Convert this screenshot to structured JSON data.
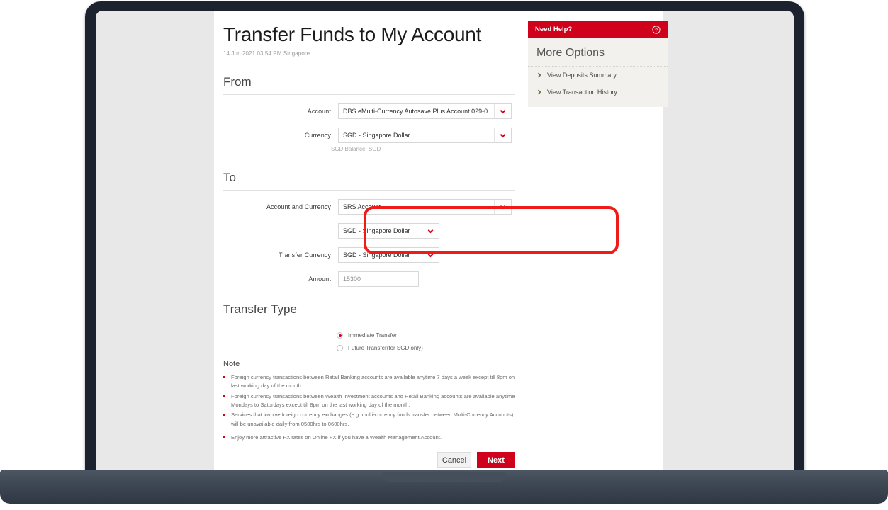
{
  "page": {
    "title": "Transfer Funds to My Account",
    "timestamp": "14 Jun 2021 03:54 PM Singapore"
  },
  "colors": {
    "brand_red": "#d0021b",
    "annotation_red": "#ee1c18",
    "sidebar_bg": "#f3f1ed",
    "page_bg": "#e8e8e8"
  },
  "from_section": {
    "heading": "From",
    "account_label": "Account",
    "account_value": "DBS eMulti-Currency Autosave Plus Account 029-0",
    "currency_label": "Currency",
    "currency_value": "SGD - Singapore Dollar",
    "balance_note": "SGD Balance: SGD '"
  },
  "to_section": {
    "heading": "To",
    "account_label": "Account and Currency",
    "account_value": "SRS Account",
    "account_currency_value": "SGD - Singapore Dollar",
    "transfer_currency_label": "Transfer Currency",
    "transfer_currency_value": "SGD - Singapore Dollar",
    "amount_label": "Amount",
    "amount_value": "15300"
  },
  "transfer_type": {
    "heading": "Transfer Type",
    "options": [
      {
        "label": "Immediate Transfer",
        "selected": true
      },
      {
        "label": "Future Transfer(for SGD only)",
        "selected": false
      }
    ]
  },
  "note": {
    "title": "Note",
    "items": [
      "Foreign currency transactions between Retail Banking accounts are available anytime 7 days a week except till 8pm on last working day of the month.",
      "Foreign currency transactions between Wealth Investment accounts and Retail Banking accounts are available anytime Mondays to Saturdays except till 8pm on the last working day of the month.",
      "Services that involve foreign currency exchanges (e.g. multi-currency funds transfer between Multi-Currency Accounts) will be unavailable daily from 0500hrs to 0600hrs.",
      "Enjoy more attractive FX rates on Online FX if you have a Wealth Management Account."
    ]
  },
  "actions": {
    "cancel_label": "Cancel",
    "next_label": "Next"
  },
  "sidebar": {
    "help_label": "Need Help?",
    "help_icon": "question-circle-icon",
    "options_title": "More Options",
    "links": [
      {
        "label": "View Deposits Summary",
        "icon": "chevron-right-icon"
      },
      {
        "label": "View Transaction History",
        "icon": "chevron-right-icon"
      }
    ]
  }
}
